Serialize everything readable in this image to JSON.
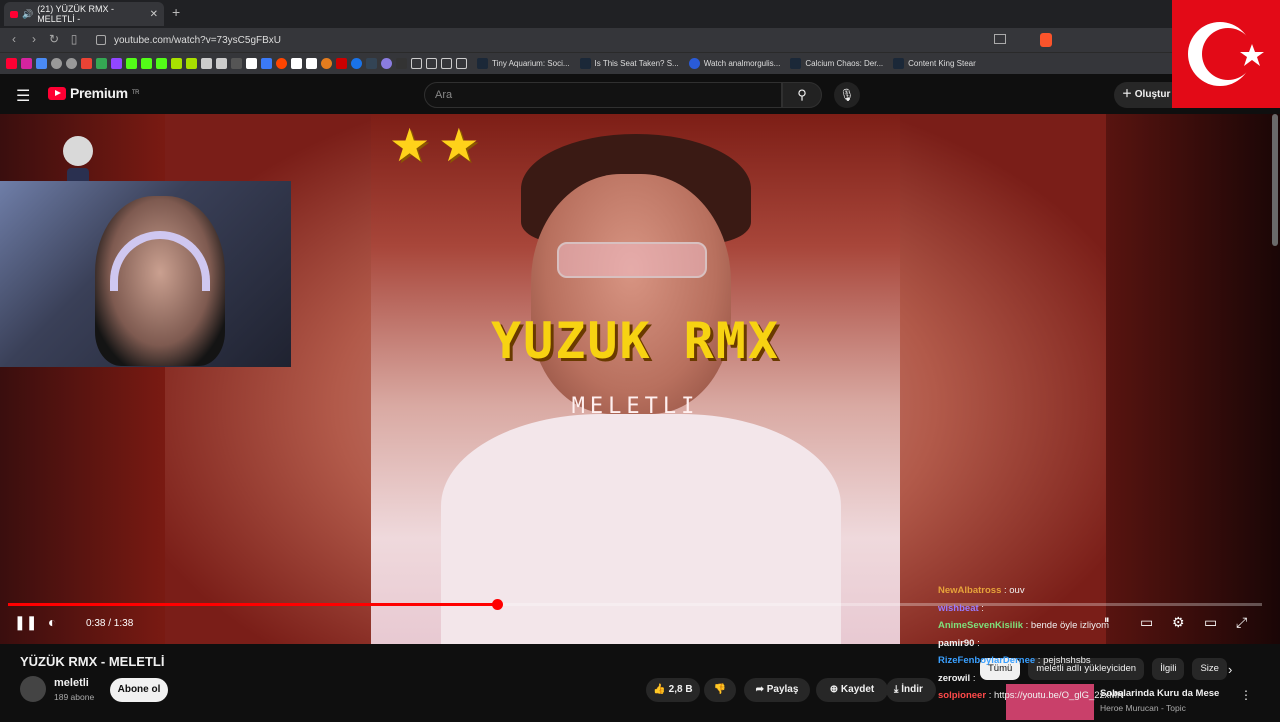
{
  "browser": {
    "tab_title": "(21) YÜZÜK RMX - MELETLİ -",
    "new_tab": "+",
    "url": "youtube.com/watch?v=73ysC5gFBxU",
    "bookmarks": [
      "Tiny Aquarium: Soci...",
      "Is This Seat Taken? S...",
      "Watch analmorgulis...",
      "Calcium Chaos: Der...",
      "Content King Stear"
    ]
  },
  "youtube": {
    "logo": "Premium",
    "logo_sup": "TR",
    "search_placeholder": "Ara",
    "create_label": "Oluştur"
  },
  "video": {
    "overlay_title": "YUZUK RMX",
    "overlay_subtitle": "MELETLI",
    "stars": "★★",
    "time": "0:38 / 1:38",
    "progress_fraction": 0.39
  },
  "chat": [
    {
      "user": "NewAlbatross",
      "msg": ": ouv",
      "color": "#e6a23a"
    },
    {
      "user": "wishbeat",
      "msg": ":",
      "color": "#9a7bff"
    },
    {
      "user": "AnimeSevenKisilik",
      "msg": ": bende öyle izliyom",
      "color": "#7ee07a"
    },
    {
      "user": "pamir90",
      "msg": ":",
      "color": "#f1f1f1"
    },
    {
      "user": "RizeFenboylarDernee",
      "msg": ": pejshshsbs",
      "color": "#3aa0ff"
    },
    {
      "user": "zerowil",
      "msg": ":",
      "color": "#f1f1f1"
    },
    {
      "user": "solpioneer",
      "msg": ": https://youtu.be/O_glG_2zxMN",
      "color": "#ff4a4a"
    }
  ],
  "info": {
    "title": "YÜZÜK RMX - MELETLİ",
    "channel": "meletli",
    "subscribers": "189 abone",
    "subscribe": "Abone ol",
    "likes": "2,8 B",
    "share": "Paylaş",
    "save": "Kaydet",
    "download": "İndir",
    "chips": [
      "Tümü",
      "meletli adlı yükleyiciden",
      "İlgili",
      "Size"
    ],
    "rec_title": "Sobalarinda Kuru da Mese",
    "rec_channel": "Heroe Murucan - Topic"
  }
}
